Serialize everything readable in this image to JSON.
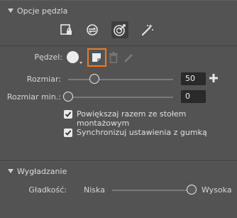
{
  "brush_options": {
    "title": "Opcje pędzla",
    "tools": [
      {
        "icon": "brush-tip-lock-icon"
      },
      {
        "icon": "transfer-settings-icon"
      },
      {
        "icon": "target-brush-icon",
        "selected": true
      },
      {
        "icon": "smoothing-brush-icon"
      }
    ],
    "brush_label": "Pędzel:",
    "size": {
      "label": "Rozmiar:",
      "value": "50",
      "fraction": 0.25
    },
    "min_size": {
      "label": "Rozmiar min.:",
      "value": "0",
      "fraction": 0.0
    },
    "checkboxes": [
      {
        "label": "Powiększaj razem ze stołem montażowym",
        "checked": true
      },
      {
        "label": "Synchronizuj ustawienia z gumką",
        "checked": true
      }
    ],
    "highlight_color": "#ee7b21"
  },
  "smoothing": {
    "title": "Wygładzanie",
    "label": "Gładkość:",
    "low_label": "Niska",
    "high_label": "Wysoka",
    "fraction": 1.0
  }
}
